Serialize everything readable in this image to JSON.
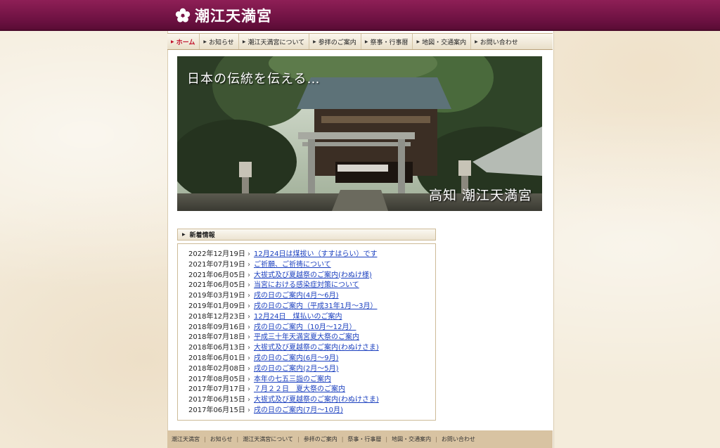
{
  "header": {
    "site_title": "潮江天満宮"
  },
  "nav": {
    "items": [
      {
        "label": "ホーム",
        "active": true
      },
      {
        "label": "お知らせ"
      },
      {
        "label": "潮江天満宮について"
      },
      {
        "label": "参拝のご案内"
      },
      {
        "label": "祭事・行事暦"
      },
      {
        "label": "地図・交通案内"
      },
      {
        "label": "お問い合わせ"
      }
    ]
  },
  "hero": {
    "tagline": "日本の伝統を伝える…",
    "caption": "高知 潮江天満宮"
  },
  "news": {
    "heading": "新着情報",
    "items": [
      {
        "date": "2022年12月19日",
        "title": "12月24日は煤祓い（すすはらい）です"
      },
      {
        "date": "2021年07月19日",
        "title": "ご祈願、ご祈祷について"
      },
      {
        "date": "2021年06月05日",
        "title": "大祓式及び夏越祭のご案内(わぬけ様)"
      },
      {
        "date": "2021年06月05日",
        "title": "当宮における感染症対策について"
      },
      {
        "date": "2019年03月19日",
        "title": "戌の日のご案内(4月〜6月)"
      },
      {
        "date": "2019年01月09日",
        "title": "戌の日のご案内（平成31年1月〜3月）"
      },
      {
        "date": "2018年12月23日",
        "title": "12月24日　煤払いのご案内"
      },
      {
        "date": "2018年09月16日",
        "title": "戌の日のご案内（10月〜12月）"
      },
      {
        "date": "2018年07月18日",
        "title": "平成三十年天満宮夏大祭のご案内"
      },
      {
        "date": "2018年06月13日",
        "title": "大祓式及び夏越祭のご案内(わぬけさま)"
      },
      {
        "date": "2018年06月01日",
        "title": "戌の日のご案内(6月〜9月)"
      },
      {
        "date": "2018年02月08日",
        "title": "戌の日のご案内(2月〜5月)"
      },
      {
        "date": "2017年08月05日",
        "title": "本年の七五三詣のご案内"
      },
      {
        "date": "2017年07月17日",
        "title": "７月２２日　夏大祭のご案内"
      },
      {
        "date": "2017年06月15日",
        "title": "大祓式及び夏越祭のご案内(わぬけさま)"
      },
      {
        "date": "2017年06月15日",
        "title": "戌の日のご案内(7月〜10月)"
      }
    ]
  },
  "footer": {
    "items": [
      "潮江天満宮",
      "お知らせ",
      "潮江天満宮について",
      "参拝のご案内",
      "祭事・行事暦",
      "地図・交通案内",
      "お問い合わせ"
    ]
  }
}
